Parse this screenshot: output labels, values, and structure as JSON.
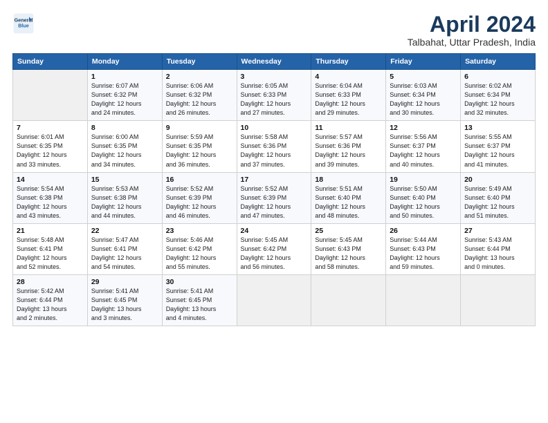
{
  "header": {
    "logo_line1": "General",
    "logo_line2": "Blue",
    "title": "April 2024",
    "subtitle": "Talbahat, Uttar Pradesh, India"
  },
  "columns": [
    "Sunday",
    "Monday",
    "Tuesday",
    "Wednesday",
    "Thursday",
    "Friday",
    "Saturday"
  ],
  "weeks": [
    [
      {
        "day": "",
        "info": ""
      },
      {
        "day": "1",
        "info": "Sunrise: 6:07 AM\nSunset: 6:32 PM\nDaylight: 12 hours\nand 24 minutes."
      },
      {
        "day": "2",
        "info": "Sunrise: 6:06 AM\nSunset: 6:32 PM\nDaylight: 12 hours\nand 26 minutes."
      },
      {
        "day": "3",
        "info": "Sunrise: 6:05 AM\nSunset: 6:33 PM\nDaylight: 12 hours\nand 27 minutes."
      },
      {
        "day": "4",
        "info": "Sunrise: 6:04 AM\nSunset: 6:33 PM\nDaylight: 12 hours\nand 29 minutes."
      },
      {
        "day": "5",
        "info": "Sunrise: 6:03 AM\nSunset: 6:34 PM\nDaylight: 12 hours\nand 30 minutes."
      },
      {
        "day": "6",
        "info": "Sunrise: 6:02 AM\nSunset: 6:34 PM\nDaylight: 12 hours\nand 32 minutes."
      }
    ],
    [
      {
        "day": "7",
        "info": "Sunrise: 6:01 AM\nSunset: 6:35 PM\nDaylight: 12 hours\nand 33 minutes."
      },
      {
        "day": "8",
        "info": "Sunrise: 6:00 AM\nSunset: 6:35 PM\nDaylight: 12 hours\nand 34 minutes."
      },
      {
        "day": "9",
        "info": "Sunrise: 5:59 AM\nSunset: 6:35 PM\nDaylight: 12 hours\nand 36 minutes."
      },
      {
        "day": "10",
        "info": "Sunrise: 5:58 AM\nSunset: 6:36 PM\nDaylight: 12 hours\nand 37 minutes."
      },
      {
        "day": "11",
        "info": "Sunrise: 5:57 AM\nSunset: 6:36 PM\nDaylight: 12 hours\nand 39 minutes."
      },
      {
        "day": "12",
        "info": "Sunrise: 5:56 AM\nSunset: 6:37 PM\nDaylight: 12 hours\nand 40 minutes."
      },
      {
        "day": "13",
        "info": "Sunrise: 5:55 AM\nSunset: 6:37 PM\nDaylight: 12 hours\nand 41 minutes."
      }
    ],
    [
      {
        "day": "14",
        "info": "Sunrise: 5:54 AM\nSunset: 6:38 PM\nDaylight: 12 hours\nand 43 minutes."
      },
      {
        "day": "15",
        "info": "Sunrise: 5:53 AM\nSunset: 6:38 PM\nDaylight: 12 hours\nand 44 minutes."
      },
      {
        "day": "16",
        "info": "Sunrise: 5:52 AM\nSunset: 6:39 PM\nDaylight: 12 hours\nand 46 minutes."
      },
      {
        "day": "17",
        "info": "Sunrise: 5:52 AM\nSunset: 6:39 PM\nDaylight: 12 hours\nand 47 minutes."
      },
      {
        "day": "18",
        "info": "Sunrise: 5:51 AM\nSunset: 6:40 PM\nDaylight: 12 hours\nand 48 minutes."
      },
      {
        "day": "19",
        "info": "Sunrise: 5:50 AM\nSunset: 6:40 PM\nDaylight: 12 hours\nand 50 minutes."
      },
      {
        "day": "20",
        "info": "Sunrise: 5:49 AM\nSunset: 6:40 PM\nDaylight: 12 hours\nand 51 minutes."
      }
    ],
    [
      {
        "day": "21",
        "info": "Sunrise: 5:48 AM\nSunset: 6:41 PM\nDaylight: 12 hours\nand 52 minutes."
      },
      {
        "day": "22",
        "info": "Sunrise: 5:47 AM\nSunset: 6:41 PM\nDaylight: 12 hours\nand 54 minutes."
      },
      {
        "day": "23",
        "info": "Sunrise: 5:46 AM\nSunset: 6:42 PM\nDaylight: 12 hours\nand 55 minutes."
      },
      {
        "day": "24",
        "info": "Sunrise: 5:45 AM\nSunset: 6:42 PM\nDaylight: 12 hours\nand 56 minutes."
      },
      {
        "day": "25",
        "info": "Sunrise: 5:45 AM\nSunset: 6:43 PM\nDaylight: 12 hours\nand 58 minutes."
      },
      {
        "day": "26",
        "info": "Sunrise: 5:44 AM\nSunset: 6:43 PM\nDaylight: 12 hours\nand 59 minutes."
      },
      {
        "day": "27",
        "info": "Sunrise: 5:43 AM\nSunset: 6:44 PM\nDaylight: 13 hours\nand 0 minutes."
      }
    ],
    [
      {
        "day": "28",
        "info": "Sunrise: 5:42 AM\nSunset: 6:44 PM\nDaylight: 13 hours\nand 2 minutes."
      },
      {
        "day": "29",
        "info": "Sunrise: 5:41 AM\nSunset: 6:45 PM\nDaylight: 13 hours\nand 3 minutes."
      },
      {
        "day": "30",
        "info": "Sunrise: 5:41 AM\nSunset: 6:45 PM\nDaylight: 13 hours\nand 4 minutes."
      },
      {
        "day": "",
        "info": ""
      },
      {
        "day": "",
        "info": ""
      },
      {
        "day": "",
        "info": ""
      },
      {
        "day": "",
        "info": ""
      }
    ]
  ]
}
